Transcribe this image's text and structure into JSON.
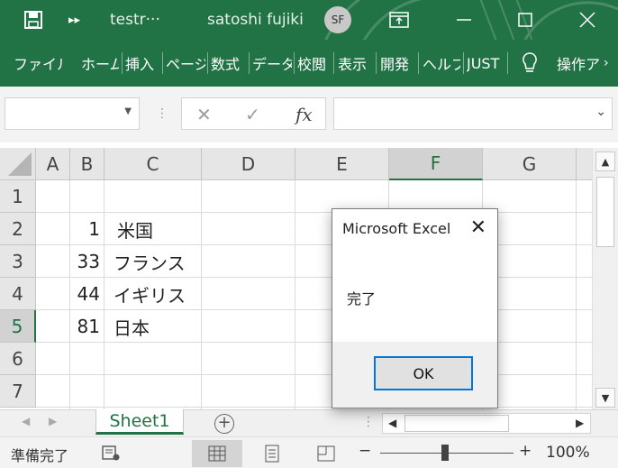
{
  "titlebar": {
    "filename": "testr···",
    "user_name": "satoshi fujiki",
    "user_initials": "SF"
  },
  "ribbon_tabs": [
    "ファイル",
    "ホーム",
    "挿入",
    "ページ",
    "数式",
    "データ",
    "校閲",
    "表示",
    "開発",
    "ヘルプ",
    "JUST",
    "操作ア"
  ],
  "formula_bar": {
    "name_box": "",
    "cancel_icon": "✕",
    "enter_icon": "✓",
    "fx_label": "fx",
    "formula": ""
  },
  "columns": [
    "A",
    "B",
    "C",
    "D",
    "E",
    "F",
    "G"
  ],
  "rows": [
    "1",
    "2",
    "3",
    "4",
    "5",
    "6",
    "7"
  ],
  "cells": {
    "B2": "1",
    "C2": "米国",
    "B3": "33",
    "C3": "フランス",
    "B4": "44",
    "C4": "イギリス",
    "B5": "81",
    "C5": "日本"
  },
  "sheet_tabs": [
    "Sheet1"
  ],
  "status": {
    "ready_text": "準備完了",
    "zoom_minus": "−",
    "zoom_plus": "+",
    "zoom_level": "100%"
  },
  "dialog": {
    "title": "Microsoft Excel",
    "message": "完了",
    "ok_label": "OK"
  },
  "colors": {
    "excel_green": "#217346",
    "dialog_focus": "#0078d7"
  }
}
